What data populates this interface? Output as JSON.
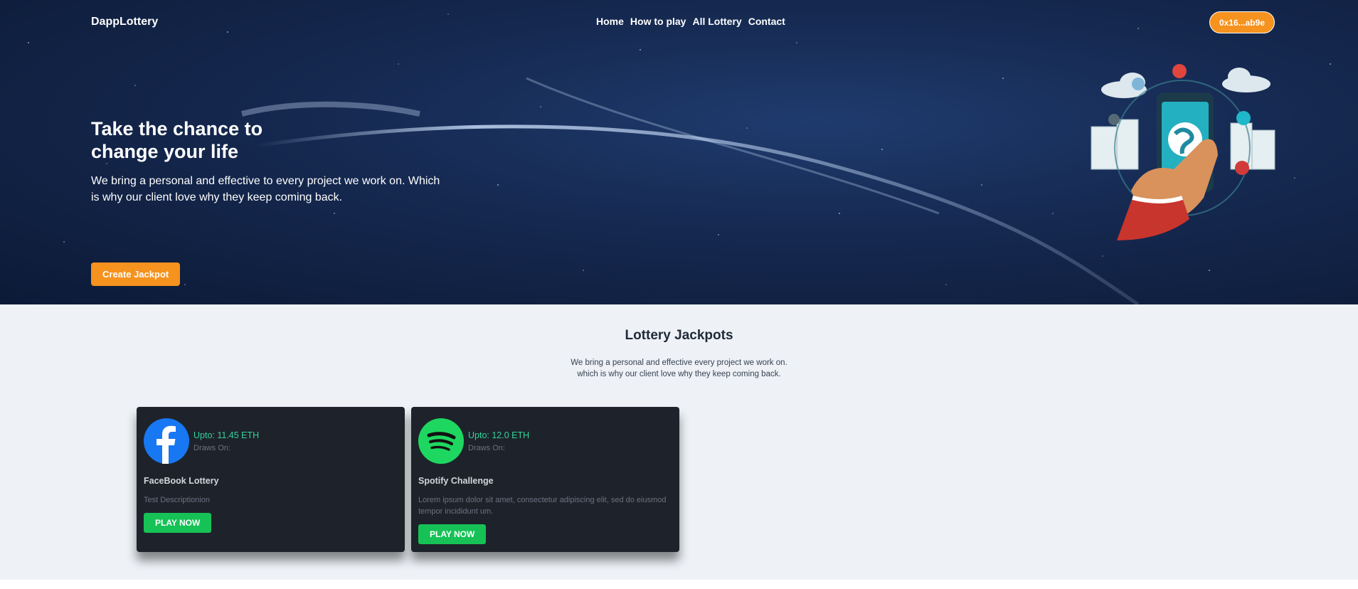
{
  "nav": {
    "brand": "DappLottery",
    "links": [
      "Home",
      "How to play",
      "All Lottery",
      "Contact"
    ],
    "wallet": "0x16...ab9e"
  },
  "hero": {
    "title": "Take the chance to change your life",
    "subtitle": "We bring a personal and effective to every project we work on. Which is why our client love why they keep coming back.",
    "cta": "Create Jackpot",
    "illustration_icon": "phone-globe-illustration"
  },
  "section": {
    "title": "Lottery Jackpots",
    "subtitle_line1": "We bring a personal and effective every project we work on.",
    "subtitle_line2": "which is why our client love why they keep coming back."
  },
  "cards": [
    {
      "prize": "Upto: 11.45 ETH",
      "draws": "Draws On:",
      "title": "FaceBook Lottery",
      "description": "Test Descriptionion",
      "button": "PLAY NOW",
      "icon": "facebook-icon",
      "icon_color": "#1877f2"
    },
    {
      "prize": "Upto: 12.0 ETH",
      "draws": "Draws On:",
      "title": "Spotify Challenge",
      "description": "Lorem ipsum dolor sit amet, consectetur adipiscing elit, sed do eiusmod tempor incididunt um.",
      "button": "PLAY NOW",
      "icon": "spotify-icon",
      "icon_color": "#1ed760"
    }
  ],
  "colors": {
    "accent": "#f6921e",
    "play_button": "#16c256",
    "prize_text": "#34d399",
    "card_bg": "#1e232b",
    "hero_bg": "#15284f"
  }
}
